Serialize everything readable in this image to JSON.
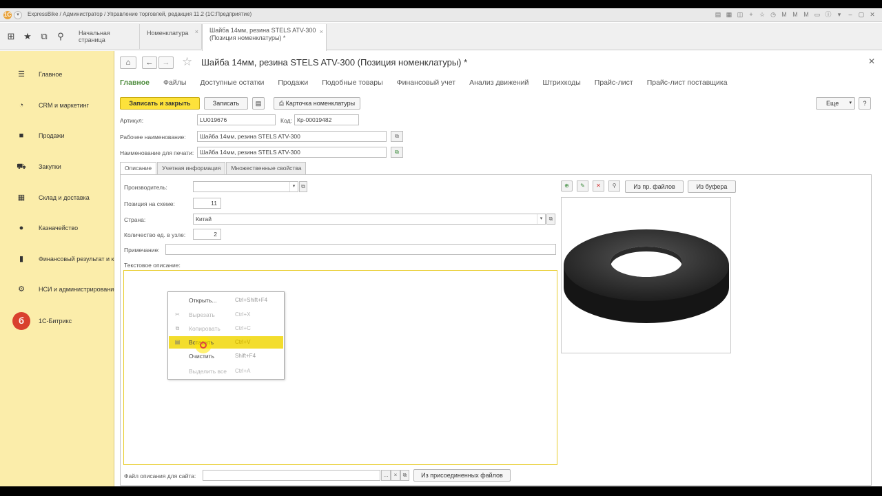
{
  "window": {
    "title": "ExpressBike / Администратор / Управление торговлей, редакция 11.2 (1С:Предприятие)"
  },
  "tabs": [
    {
      "label": "Начальная страница"
    },
    {
      "label": "Номенклатура"
    },
    {
      "label": "Шайба 14мм, резина STELS ATV-300",
      "label2": "(Позиция номенклатуры) *"
    }
  ],
  "sidebar": {
    "items": [
      {
        "label": "Главное",
        "icon": "menu-icon"
      },
      {
        "label": "CRM и маркетинг",
        "icon": "pie-chart-icon"
      },
      {
        "label": "Продажи",
        "icon": "bag-icon"
      },
      {
        "label": "Закупки",
        "icon": "cart-icon"
      },
      {
        "label": "Склад и доставка",
        "icon": "grid-icon"
      },
      {
        "label": "Казначейство",
        "icon": "coin-icon"
      },
      {
        "label": "Финансовый результат и контроллинг",
        "icon": "bar-chart-icon"
      },
      {
        "label": "НСИ и администрирование",
        "icon": "gear-icon"
      },
      {
        "label": "1С-Битрикс",
        "icon": "bitrix-icon"
      }
    ]
  },
  "page": {
    "title": "Шайба 14мм, резина STELS ATV-300 (Позиция номенклатуры) *"
  },
  "subnav": [
    "Главное",
    "Файлы",
    "Доступные остатки",
    "Продажи",
    "Подобные товары",
    "Финансовый учет",
    "Анализ движений",
    "Штрихкоды",
    "Прайс-лист",
    "Прайс-лист поставщика"
  ],
  "toolbar": {
    "save_close": "Записать и закрыть",
    "save": "Записать",
    "card": "Карточка номенклатуры",
    "more": "Еще",
    "help": "?"
  },
  "form": {
    "article_label": "Артикул:",
    "article_value": "LU019676",
    "code_label": "Код:",
    "code_value": "Кр-00019482",
    "work_name_label": "Рабочее наименование:",
    "work_name_value": "Шайба 14мм, резина STELS ATV-300",
    "print_name_label": "Наименование для печати:",
    "print_name_value": "Шайба 14мм, резина STELS ATV-300"
  },
  "inner_tabs": [
    "Описание",
    "Учетная информация",
    "Множественные свойства"
  ],
  "description": {
    "manufacturer_label": "Производитель:",
    "manufacturer_value": "",
    "scheme_pos_label": "Позиция на схеме:",
    "scheme_pos_value": "11",
    "country_label": "Страна:",
    "country_value": "Китай",
    "qty_label": "Количество ед. в узле:",
    "qty_value": "2",
    "note_label": "Примечание:",
    "note_value": "",
    "text_label": "Текстовое описание:",
    "file_label": "Файл описания для сайта:",
    "attached_btn": "Из присоединенных файлов"
  },
  "image_tools": {
    "from_files": "Из пр. файлов",
    "from_buffer": "Из буфера"
  },
  "context_menu": [
    {
      "label": "Открыть...",
      "shortcut": "Ctrl+Shift+F4",
      "disabled": false
    },
    {
      "label": "Вырезать",
      "shortcut": "Ctrl+X",
      "disabled": true
    },
    {
      "label": "Копировать",
      "shortcut": "Ctrl+C",
      "disabled": true
    },
    {
      "label": "Вставить",
      "shortcut": "Ctrl+V",
      "disabled": false,
      "selected": true
    },
    {
      "label": "Очистить",
      "shortcut": "Shift+F4",
      "disabled": false
    },
    {
      "label": "Выделить все",
      "shortcut": "Ctrl+A",
      "disabled": true
    }
  ],
  "colors": {
    "sidebar_bg": "#fbedaa",
    "primary_button": "#fde23b",
    "active_subnav": "#4b8a3a",
    "selection": "#f3dd2d"
  }
}
